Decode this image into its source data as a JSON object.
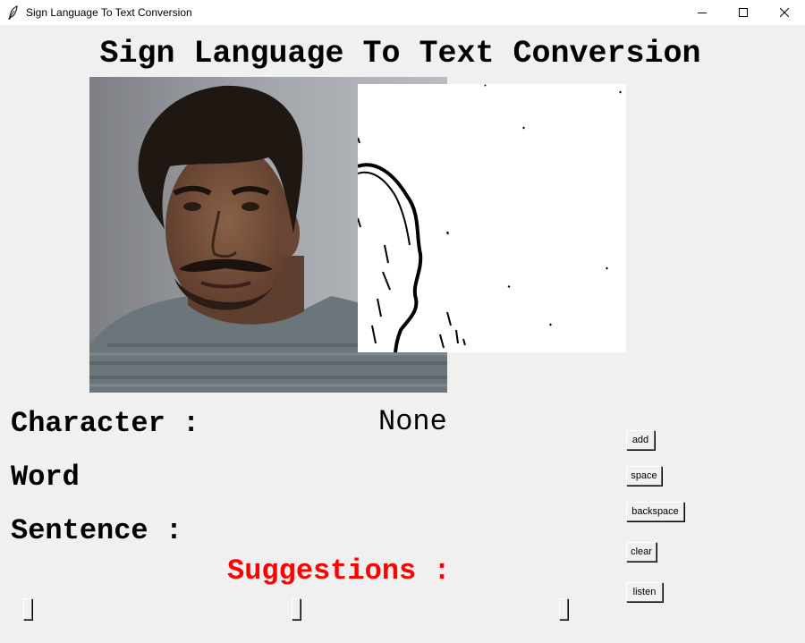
{
  "window": {
    "title": "Sign Language To Text Conversion",
    "icon": "feather-icon",
    "controls": [
      "minimize-icon",
      "maximize-icon",
      "close-icon"
    ]
  },
  "heading": "Sign Language To Text Conversion",
  "panels": {
    "camera_feed": "webcam-image",
    "hand_mask": "hand-edge-mask-image"
  },
  "labels": {
    "character": "Character :",
    "character_value": "None",
    "word": "Word",
    "sentence": "Sentence :",
    "suggestions": "Suggestions :"
  },
  "buttons": {
    "add": "add",
    "space": "space",
    "backspace": "backspace",
    "clear": "clear",
    "listen": "listen"
  },
  "suggestions": [
    "",
    "",
    ""
  ],
  "colors": {
    "background": "#f0f0f0",
    "suggestions_label": "#ff0000",
    "text": "#000000"
  }
}
